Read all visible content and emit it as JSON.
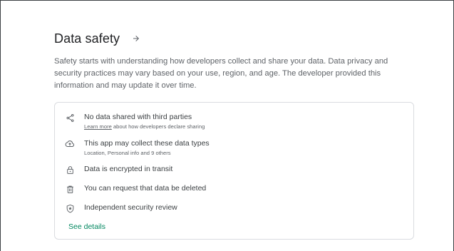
{
  "section": {
    "title": "Data safety",
    "description": "Safety starts with understanding how developers collect and share your data. Data privacy and security practices may vary based on your use, region, and age. The developer provided this information and may update it over time."
  },
  "items": [
    {
      "icon": "share-icon",
      "text": "No data shared with third parties",
      "sub_link": "Learn more",
      "sub_text": " about how developers declare sharing"
    },
    {
      "icon": "cloud-upload-icon",
      "text": "This app may collect these data types",
      "sub_text": "Location, Personal info and 9 others"
    },
    {
      "icon": "lock-icon",
      "text": "Data is encrypted in transit"
    },
    {
      "icon": "trash-icon",
      "text": "You can request that data be deleted"
    },
    {
      "icon": "shield-icon",
      "text": "Independent security review"
    }
  ],
  "see_details": "See details",
  "colors": {
    "accent": "#01875f",
    "text": "#202124",
    "muted": "#5f6368",
    "border": "#dadce0"
  }
}
